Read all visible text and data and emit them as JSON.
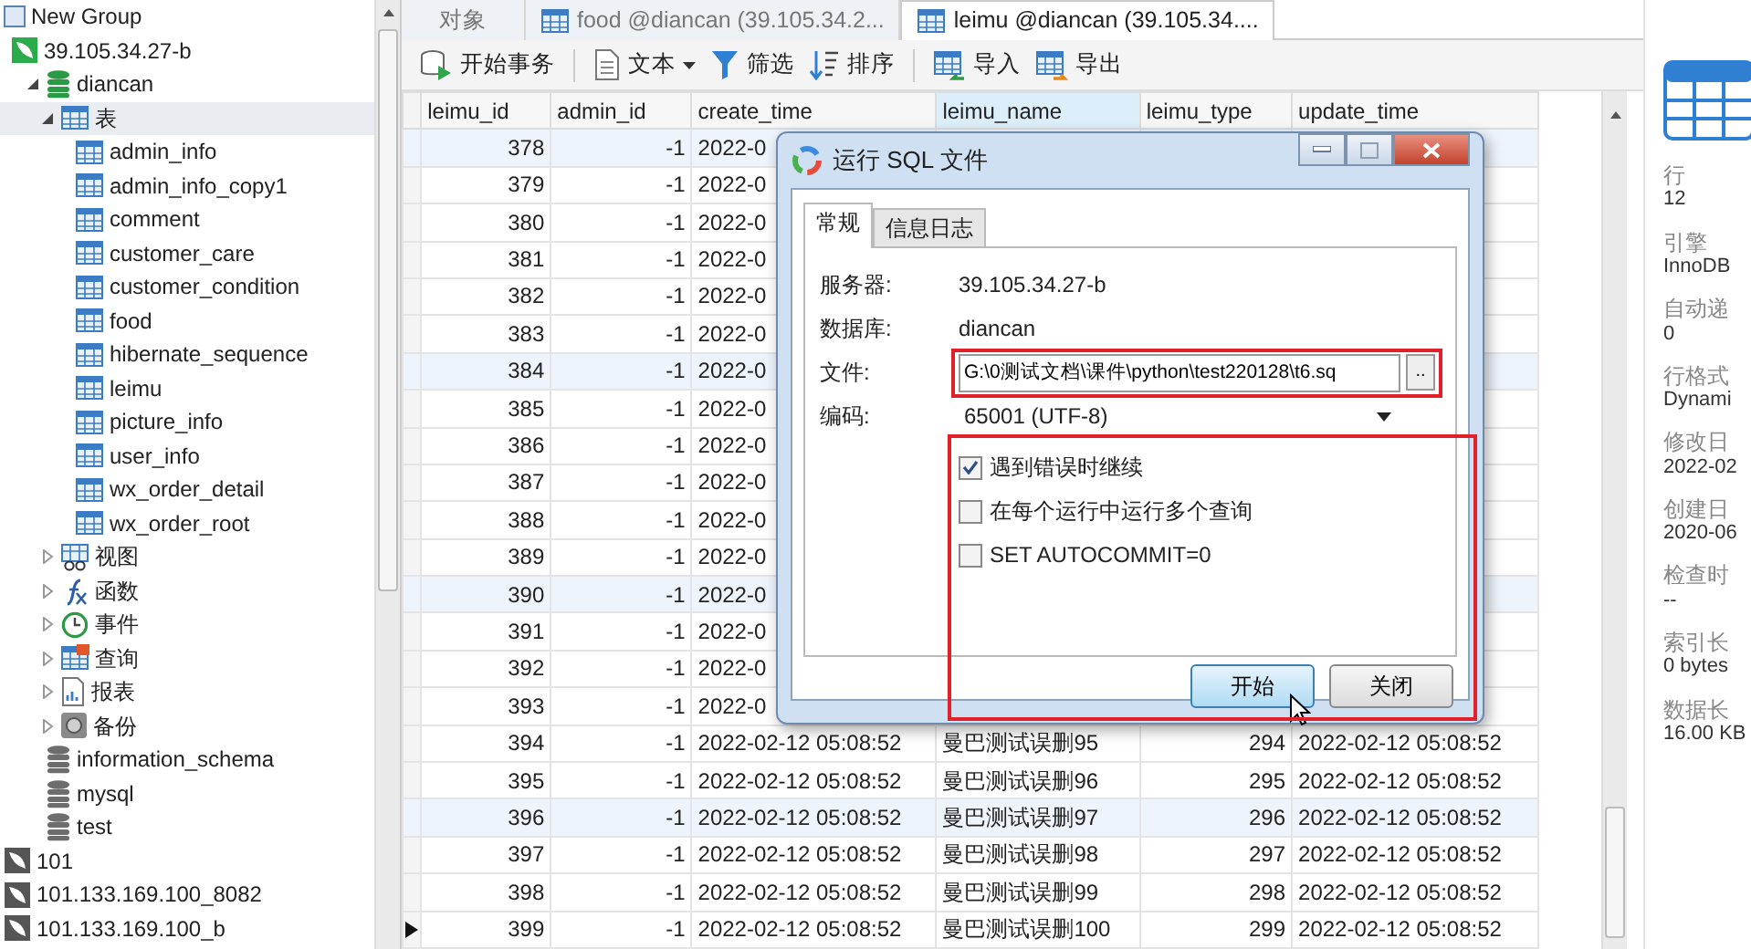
{
  "tree": [
    {
      "label": "New Group",
      "kind": "group",
      "children": [
        {
          "label": "39.105.34.27-b",
          "kind": "connection",
          "open": true,
          "children": [
            {
              "label": "diancan",
              "kind": "database",
              "open": true,
              "expanded": true,
              "children": [
                {
                  "label": "表",
                  "kind": "tables",
                  "expanded": true,
                  "selected": true,
                  "children": [
                    {
                      "label": "admin_info",
                      "kind": "table"
                    },
                    {
                      "label": "admin_info_copy1",
                      "kind": "table"
                    },
                    {
                      "label": "comment",
                      "kind": "table"
                    },
                    {
                      "label": "customer_care",
                      "kind": "table"
                    },
                    {
                      "label": "customer_condition",
                      "kind": "table"
                    },
                    {
                      "label": "food",
                      "kind": "table"
                    },
                    {
                      "label": "hibernate_sequence",
                      "kind": "table"
                    },
                    {
                      "label": "leimu",
                      "kind": "table"
                    },
                    {
                      "label": "picture_info",
                      "kind": "table"
                    },
                    {
                      "label": "user_info",
                      "kind": "table"
                    },
                    {
                      "label": "wx_order_detail",
                      "kind": "table"
                    },
                    {
                      "label": "wx_order_root",
                      "kind": "table"
                    }
                  ]
                },
                {
                  "label": "视图",
                  "kind": "views",
                  "expanded": false,
                  "selected": false
                },
                {
                  "label": "函数",
                  "kind": "functions",
                  "expanded": false,
                  "selected": false
                },
                {
                  "label": "事件",
                  "kind": "events",
                  "expanded": false,
                  "selected": false
                },
                {
                  "label": "查询",
                  "kind": "queries",
                  "expanded": false,
                  "selected": false
                },
                {
                  "label": "报表",
                  "kind": "reports",
                  "expanded": false,
                  "selected": false
                },
                {
                  "label": "备份",
                  "kind": "backups",
                  "expanded": false,
                  "selected": false
                }
              ]
            },
            {
              "label": "information_schema",
              "kind": "database",
              "open": false
            },
            {
              "label": "mysql",
              "kind": "database",
              "open": false
            },
            {
              "label": "test",
              "kind": "database",
              "open": false
            }
          ]
        }
      ]
    },
    {
      "label": "101",
      "kind": "connection",
      "open": false
    },
    {
      "label": "101.133.169.100_8082",
      "kind": "connection",
      "open": false
    },
    {
      "label": "101.133.169.100_b",
      "kind": "connection",
      "open": false
    }
  ],
  "tabs": [
    {
      "label": "对象",
      "kind": "objects",
      "selected": false
    },
    {
      "label": "food @diancan (39.105.34.2...",
      "kind": "table",
      "selected": false
    },
    {
      "label": "leimu @diancan (39.105.34....",
      "kind": "table",
      "selected": true
    }
  ],
  "toolbar": [
    [
      {
        "label": "开始事务",
        "kind": "transaction",
        "dropdown": false
      }
    ],
    [
      {
        "label": "文本",
        "kind": "text",
        "dropdown": true
      },
      {
        "label": "筛选",
        "kind": "filter",
        "dropdown": false
      },
      {
        "label": "排序",
        "kind": "sort",
        "dropdown": false
      }
    ],
    [
      {
        "label": "导入",
        "kind": "import",
        "dropdown": false
      },
      {
        "label": "导出",
        "kind": "export",
        "dropdown": false
      }
    ]
  ],
  "grid": {
    "columns": [
      {
        "label": "leimu_id",
        "kind": "number",
        "selected": false
      },
      {
        "label": "admin_id",
        "kind": "number",
        "selected": false
      },
      {
        "label": "create_time",
        "kind": "text",
        "selected": false
      },
      {
        "label": "leimu_name",
        "kind": "text",
        "selected": true
      },
      {
        "label": "leimu_type",
        "kind": "number",
        "selected": false
      },
      {
        "label": "update_time",
        "kind": "text",
        "selected": false
      }
    ],
    "rows": [
      {
        "cells": [
          "378",
          "-1",
          "2022-0"
        ],
        "highlighted": true,
        "current": false
      },
      {
        "cells": [
          "379",
          "-1",
          "2022-0"
        ],
        "highlighted": false,
        "current": false
      },
      {
        "cells": [
          "380",
          "-1",
          "2022-0"
        ],
        "highlighted": false,
        "current": false
      },
      {
        "cells": [
          "381",
          "-1",
          "2022-0"
        ],
        "highlighted": false,
        "current": false
      },
      {
        "cells": [
          "382",
          "-1",
          "2022-0"
        ],
        "highlighted": false,
        "current": false
      },
      {
        "cells": [
          "383",
          "-1",
          "2022-0"
        ],
        "highlighted": false,
        "current": false
      },
      {
        "cells": [
          "384",
          "-1",
          "2022-0"
        ],
        "highlighted": true,
        "current": false
      },
      {
        "cells": [
          "385",
          "-1",
          "2022-0"
        ],
        "highlighted": false,
        "current": false
      },
      {
        "cells": [
          "386",
          "-1",
          "2022-0"
        ],
        "highlighted": false,
        "current": false
      },
      {
        "cells": [
          "387",
          "-1",
          "2022-0"
        ],
        "highlighted": false,
        "current": false
      },
      {
        "cells": [
          "388",
          "-1",
          "2022-0"
        ],
        "highlighted": false,
        "current": false
      },
      {
        "cells": [
          "389",
          "-1",
          "2022-0"
        ],
        "highlighted": false,
        "current": false
      },
      {
        "cells": [
          "390",
          "-1",
          "2022-0"
        ],
        "highlighted": true,
        "current": false
      },
      {
        "cells": [
          "391",
          "-1",
          "2022-0"
        ],
        "highlighted": false,
        "current": false
      },
      {
        "cells": [
          "392",
          "-1",
          "2022-0"
        ],
        "highlighted": false,
        "current": false
      },
      {
        "cells": [
          "393",
          "-1",
          "2022-0"
        ],
        "highlighted": false,
        "current": false
      },
      {
        "cells": [
          "394",
          "-1",
          "2022-02-12 05:08:52",
          "曼巴测试误删95",
          "294",
          "2022-02-12 05:08:52"
        ],
        "highlighted": false,
        "current": false
      },
      {
        "cells": [
          "395",
          "-1",
          "2022-02-12 05:08:52",
          "曼巴测试误删96",
          "295",
          "2022-02-12 05:08:52"
        ],
        "highlighted": false,
        "current": false
      },
      {
        "cells": [
          "396",
          "-1",
          "2022-02-12 05:08:52",
          "曼巴测试误删97",
          "296",
          "2022-02-12 05:08:52"
        ],
        "highlighted": true,
        "current": false
      },
      {
        "cells": [
          "397",
          "-1",
          "2022-02-12 05:08:52",
          "曼巴测试误删98",
          "297",
          "2022-02-12 05:08:52"
        ],
        "highlighted": false,
        "current": false
      },
      {
        "cells": [
          "398",
          "-1",
          "2022-02-12 05:08:52",
          "曼巴测试误删99",
          "298",
          "2022-02-12 05:08:52"
        ],
        "highlighted": false,
        "current": false
      },
      {
        "cells": [
          "399",
          "-1",
          "2022-02-12 05:08:52",
          "曼巴测试误删100",
          "299",
          "2022-02-12 05:08:52"
        ],
        "highlighted": false,
        "current": true
      }
    ]
  },
  "properties": [
    {
      "label": "行",
      "value": "12"
    },
    {
      "label": "引擎",
      "value": "InnoDB"
    },
    {
      "label": "自动递",
      "value": "0"
    },
    {
      "label": "行格式",
      "value": "Dynami"
    },
    {
      "label": "修改日",
      "value": "2022-02"
    },
    {
      "label": "创建日",
      "value": "2020-06"
    },
    {
      "label": "检查时",
      "value": "--"
    },
    {
      "label": "索引长",
      "value": "0 bytes"
    },
    {
      "label": "数据长",
      "value": "16.00 KB"
    }
  ],
  "dialog": {
    "title": "运行 SQL 文件",
    "tabs": [
      {
        "label": "常规",
        "selected": true
      },
      {
        "label": "信息日志",
        "selected": false
      }
    ],
    "fields": [
      {
        "label": "服务器:",
        "kind": "text",
        "value": "39.105.34.27-b",
        "annotated": false
      },
      {
        "label": "数据库:",
        "kind": "text",
        "value": "diancan",
        "annotated": false
      },
      {
        "label": "文件:",
        "kind": "file",
        "value": "G:\\0测试文档\\课件\\python\\test220128\\t6.sq",
        "browse": "..",
        "annotated": true
      },
      {
        "label": "编码:",
        "kind": "select",
        "value": "65001 (UTF-8)",
        "annotated": false
      }
    ],
    "options": {
      "annotated": true,
      "items": [
        {
          "label": "遇到错误时继续",
          "checked": true
        },
        {
          "label": "在每个运行中运行多个查询",
          "checked": false
        },
        {
          "label": "SET AUTOCOMMIT=0",
          "checked": false
        }
      ]
    },
    "buttons": [
      {
        "label": "开始",
        "default": true
      },
      {
        "label": "关闭",
        "default": false
      }
    ]
  }
}
